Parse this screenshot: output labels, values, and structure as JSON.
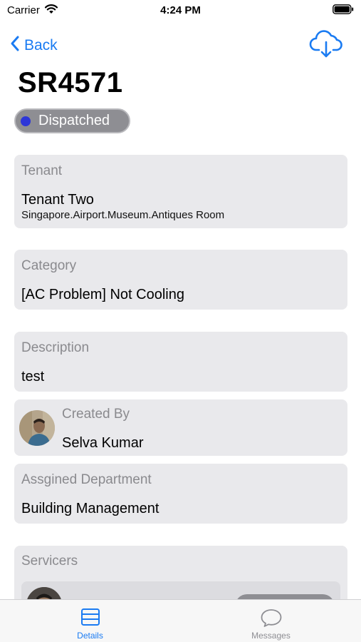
{
  "status_bar": {
    "carrier": "Carrier",
    "time": "4:24 PM"
  },
  "nav": {
    "back_label": "Back",
    "download_icon": "cloud-download-icon"
  },
  "request": {
    "id": "SR4571",
    "status": "Dispatched",
    "status_color": "#2d36d8"
  },
  "tenant": {
    "label": "Tenant",
    "name": "Tenant Two",
    "location": "Singapore.Airport.Museum.Antiques Room"
  },
  "category": {
    "label": "Category",
    "value": "[AC Problem] Not Cooling"
  },
  "description": {
    "label": "Description",
    "value": "test"
  },
  "created_by": {
    "label": "Created By",
    "name": "Selva Kumar"
  },
  "department": {
    "label": "Assgined Department",
    "value": "Building Management"
  },
  "servicers": {
    "label": "Servicers",
    "first_name_partial": ""
  },
  "tabs": [
    {
      "label": "Details",
      "icon": "list-icon",
      "active": true
    },
    {
      "label": "Messages",
      "icon": "chat-bubble-icon",
      "active": false
    }
  ],
  "colors": {
    "accent": "#1a7bf2",
    "card_bg": "#e9e9ec",
    "pill_bg": "#8e8e93"
  }
}
